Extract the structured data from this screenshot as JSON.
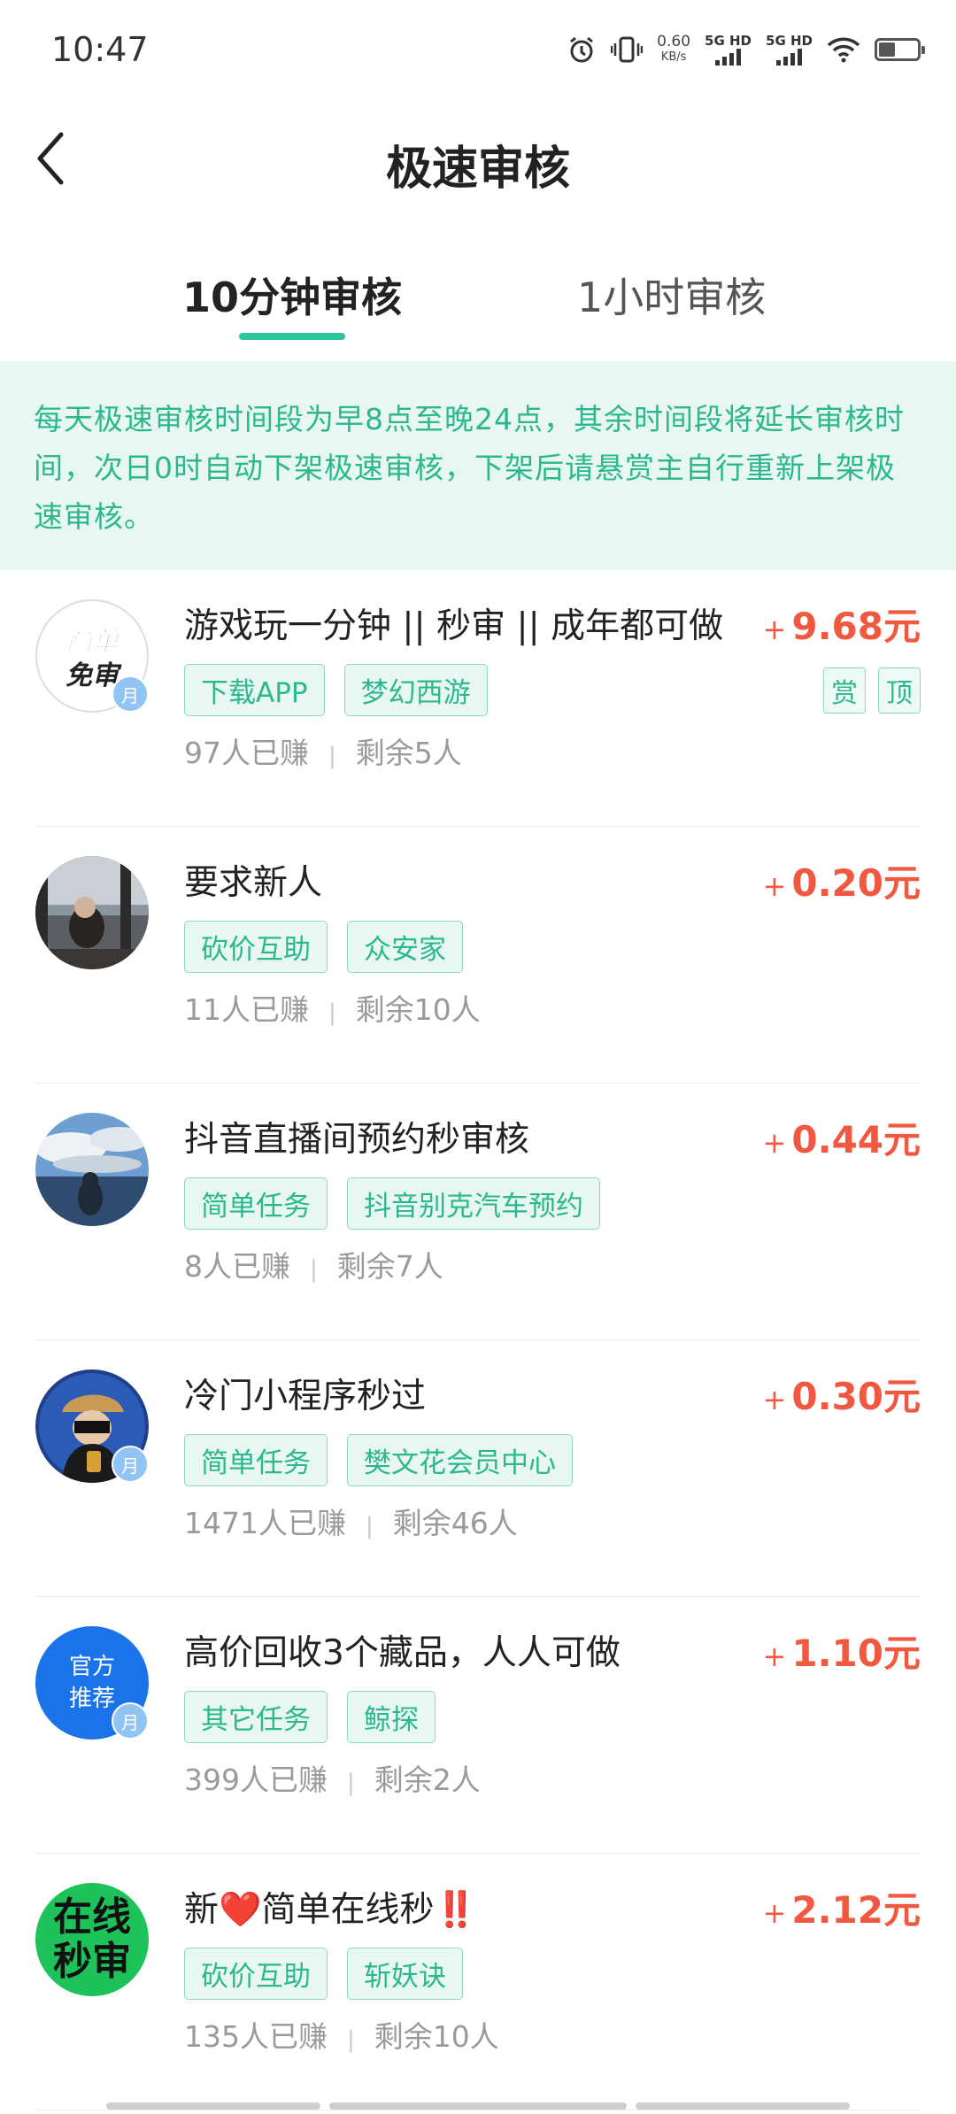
{
  "status_bar": {
    "time": "10:47",
    "net_speed_value": "0.60",
    "net_speed_unit": "KB/s",
    "sim1_label": "5G HD",
    "sim2_label": "5G HD"
  },
  "nav": {
    "title": "极速审核"
  },
  "tabs": [
    {
      "label": "10分钟审核",
      "active": true
    },
    {
      "label": "1小时审核",
      "active": false
    }
  ],
  "notice": {
    "text": "每天极速审核时间段为早8点至晚24点，其余时间段将延长审核时间，次日0时自动下架极速审核，下架后请悬赏主自行重新上架极速审核。"
  },
  "tasks": [
    {
      "title": "游戏玩一分钟 || 秒审 || 成年都可做",
      "price_sign": "+",
      "price": "9.68元",
      "tags": [
        "下载APP",
        "梦幻西游"
      ],
      "flags": [
        "赏",
        "顶"
      ],
      "earned": "97人已赚",
      "remaining": "剩余5人",
      "avatar_text": "简单免审",
      "badge": "月"
    },
    {
      "title": "要求新人",
      "price_sign": "+",
      "price": "0.20元",
      "tags": [
        "砍价互助",
        "众安家"
      ],
      "earned": "11人已赚",
      "remaining": "剩余10人"
    },
    {
      "title": "抖音直播间预约秒审核",
      "price_sign": "+",
      "price": "0.44元",
      "tags": [
        "简单任务",
        "抖音别克汽车预约"
      ],
      "earned": "8人已赚",
      "remaining": "剩余7人"
    },
    {
      "title": "冷门小程序秒过",
      "price_sign": "+",
      "price": "0.30元",
      "tags": [
        "简单任务",
        "樊文花会员中心"
      ],
      "earned": "1471人已赚",
      "remaining": "剩余46人",
      "badge": "月"
    },
    {
      "title": "高价回收3个藏品，人人可做",
      "price_sign": "+",
      "price": "1.10元",
      "tags": [
        "其它任务",
        "鲸探"
      ],
      "earned": "399人已赚",
      "remaining": "剩余2人",
      "avatar_text_line1": "官方",
      "avatar_text_line2": "推荐",
      "badge": "月"
    },
    {
      "title": "新❤️简单在线秒‼️",
      "price_sign": "+",
      "price": "2.12元",
      "tags": [
        "砍价互助",
        "斩妖诀"
      ],
      "earned": "135人已赚",
      "remaining": "剩余10人",
      "avatar_text_line1": "在线",
      "avatar_text_line2": "秒审"
    }
  ],
  "colors": {
    "accent": "#2cc79a",
    "accent_text": "#2cb88e",
    "notice_bg": "#e8f7f1",
    "price": "#f0583f",
    "meta": "#9a9a9a"
  }
}
